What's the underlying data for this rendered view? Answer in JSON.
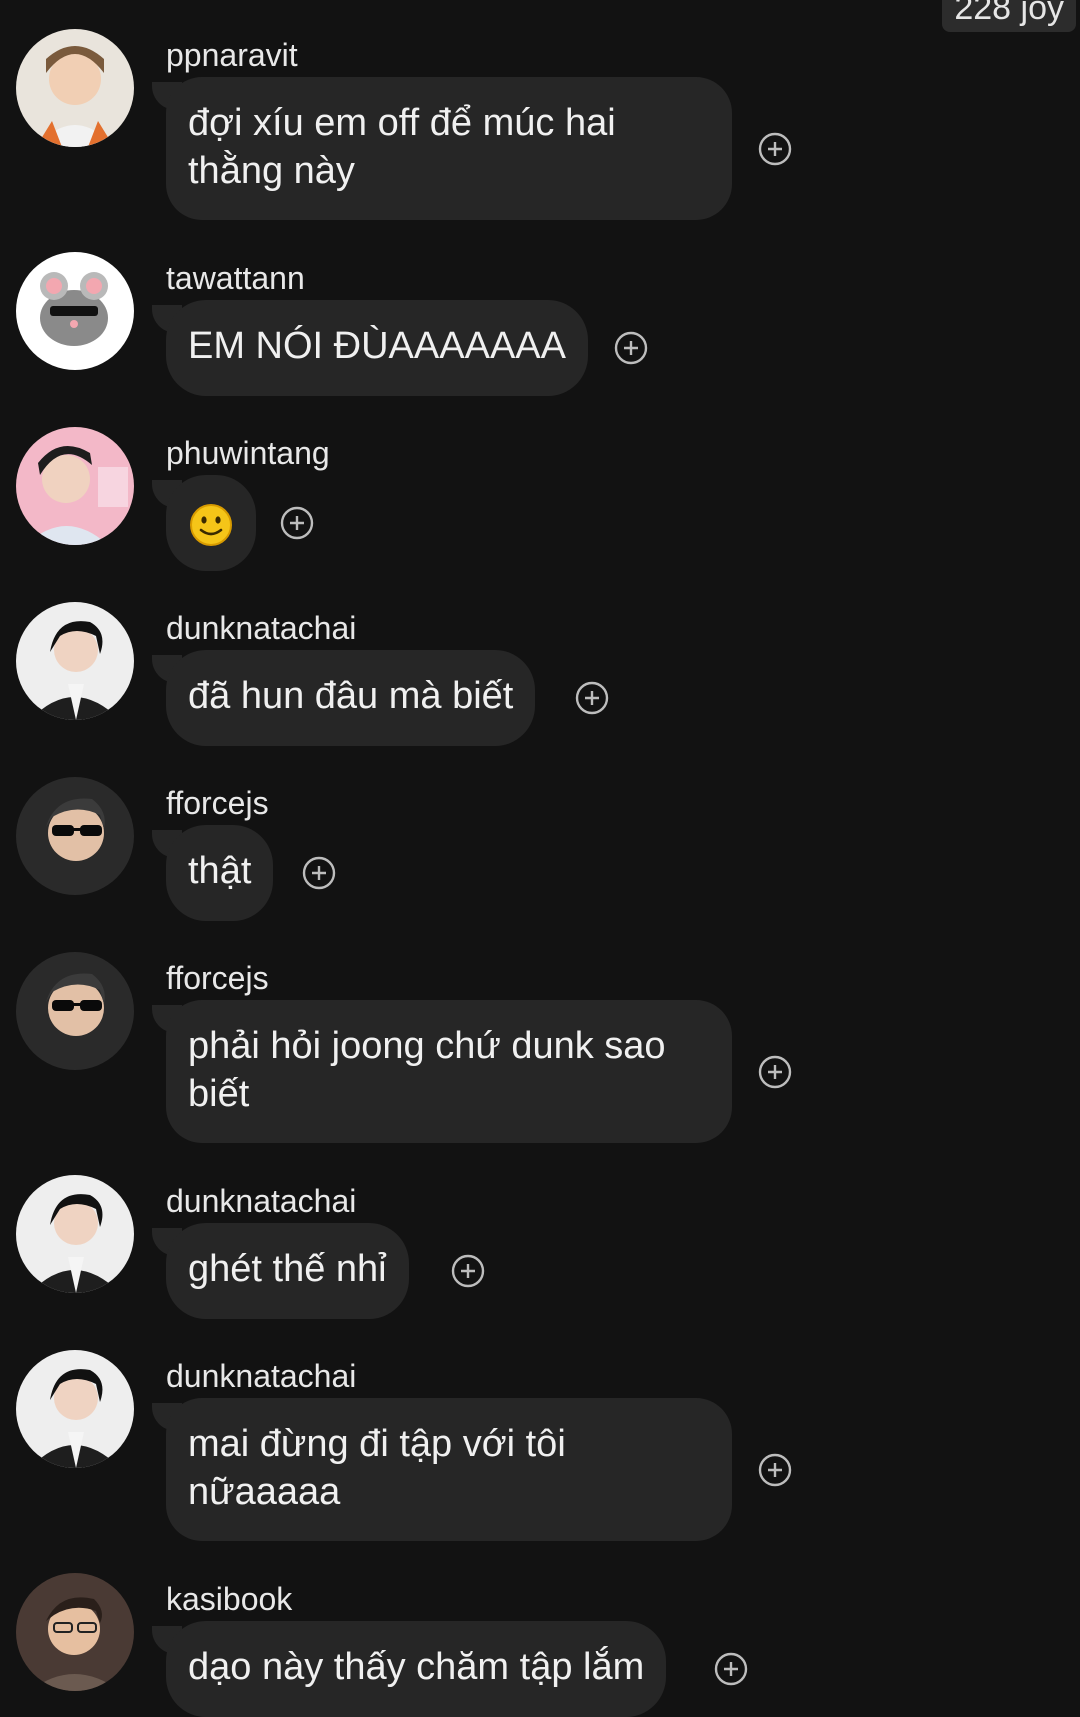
{
  "header": {
    "badge_text": "228 joy"
  },
  "messages": [
    {
      "username": "ppnaravit",
      "text": "đợi xíu em off để múc hai thằng này"
    },
    {
      "username": "tawattann",
      "text": "EM NÓI ĐÙAAAAAAA"
    },
    {
      "username": "phuwintang",
      "text": "",
      "emoji": "slightly-smiling-face"
    },
    {
      "username": "dunknatachai",
      "text": "đã hun đâu mà biết"
    },
    {
      "username": "fforcejs",
      "text": "thật"
    },
    {
      "username": "fforcejs",
      "text": "phải hỏi joong chứ dunk sao biết"
    },
    {
      "username": "dunknatachai",
      "text": "ghét thế nhỉ"
    },
    {
      "username": "dunknatachai",
      "text": "mai đừng đi tập với tôi nữaaaaa"
    },
    {
      "username": "kasibook",
      "text": "dạo này thấy chăm tập lắm"
    }
  ],
  "icons": {
    "reaction": "add-reaction-icon",
    "avatar": "user-avatar"
  },
  "colors": {
    "background": "#121212",
    "bubble": "#262626",
    "text": "#f0f0f0",
    "icon": "#bdbdbd"
  }
}
